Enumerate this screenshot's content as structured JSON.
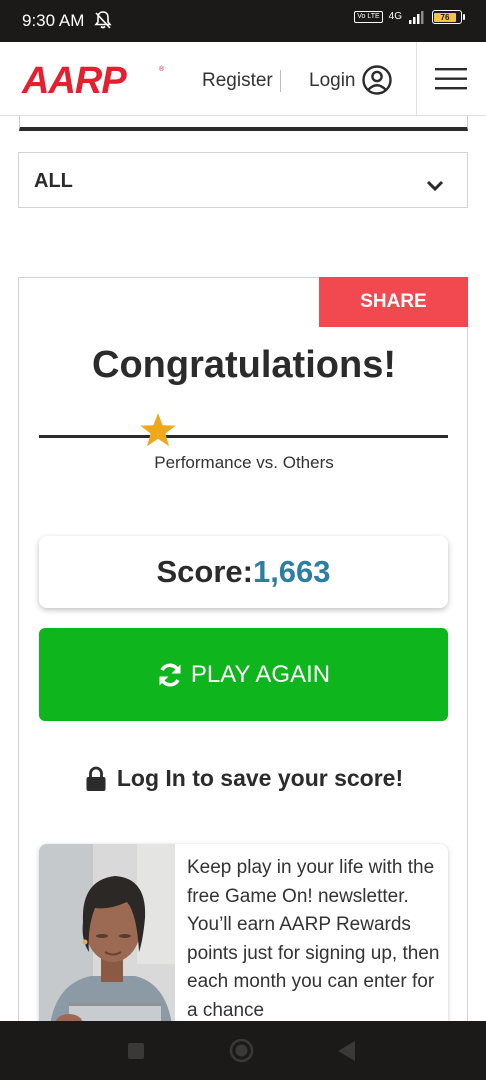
{
  "status_bar": {
    "time": "9:30 AM",
    "network": "4G",
    "volte": "Vo LTE",
    "battery": "76"
  },
  "header": {
    "logo_text": "AARP",
    "register_label": "Register",
    "login_label": "Login"
  },
  "filter": {
    "selected": "ALL"
  },
  "result": {
    "share_label": "SHARE",
    "title": "Congratulations!",
    "performance_label": "Performance vs. Others",
    "performance_fraction": 0.29,
    "score_label": "Score:",
    "score_value": "1,663",
    "play_again_label": "PLAY AGAIN",
    "save_prompt": "Log In to save your score!"
  },
  "promo": {
    "text": "Keep play in your life with the free Game On! newsletter. You’ll earn AARP Rewards points just for signing up, then each month you can enter for a chance"
  },
  "colors": {
    "brand_red": "#e4202e",
    "share_red": "#f2484f",
    "play_green": "#0fb51c",
    "score_blue": "#2c7ea2",
    "star_gold": "#f0a81b"
  }
}
